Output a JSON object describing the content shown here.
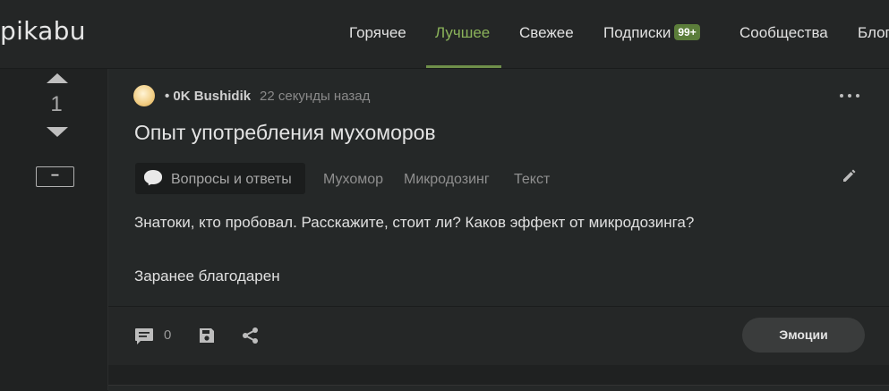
{
  "header": {
    "logo": "pikabu",
    "nav": [
      {
        "label": "Горячее"
      },
      {
        "label": "Лучшее",
        "active": true
      },
      {
        "label": "Свежее"
      },
      {
        "label": "Подписки",
        "badge": "99+"
      },
      {
        "label": "Сообщества"
      },
      {
        "label": "Блоги"
      }
    ]
  },
  "vote": {
    "count": "1",
    "collapse_label": "−"
  },
  "post": {
    "author": "• 0K Bushidik",
    "time": "22 секунды назад",
    "title": "Опыт употребления мухоморов",
    "category_tag": "Вопросы и ответы",
    "tags": [
      "Мухомор",
      "Микродозинг",
      "Текст"
    ],
    "body": [
      "Знатоки, кто пробовал. Расскажите, стоит ли? Каков эффект от микродозинга?",
      "Заранее благодарен"
    ]
  },
  "footer": {
    "comments_count": "0",
    "emotions_label": "Эмоции"
  },
  "colors": {
    "background": "#1f2121",
    "card": "#252828",
    "accent_green": "#8bb35a",
    "badge_green": "#5b7d3a"
  }
}
